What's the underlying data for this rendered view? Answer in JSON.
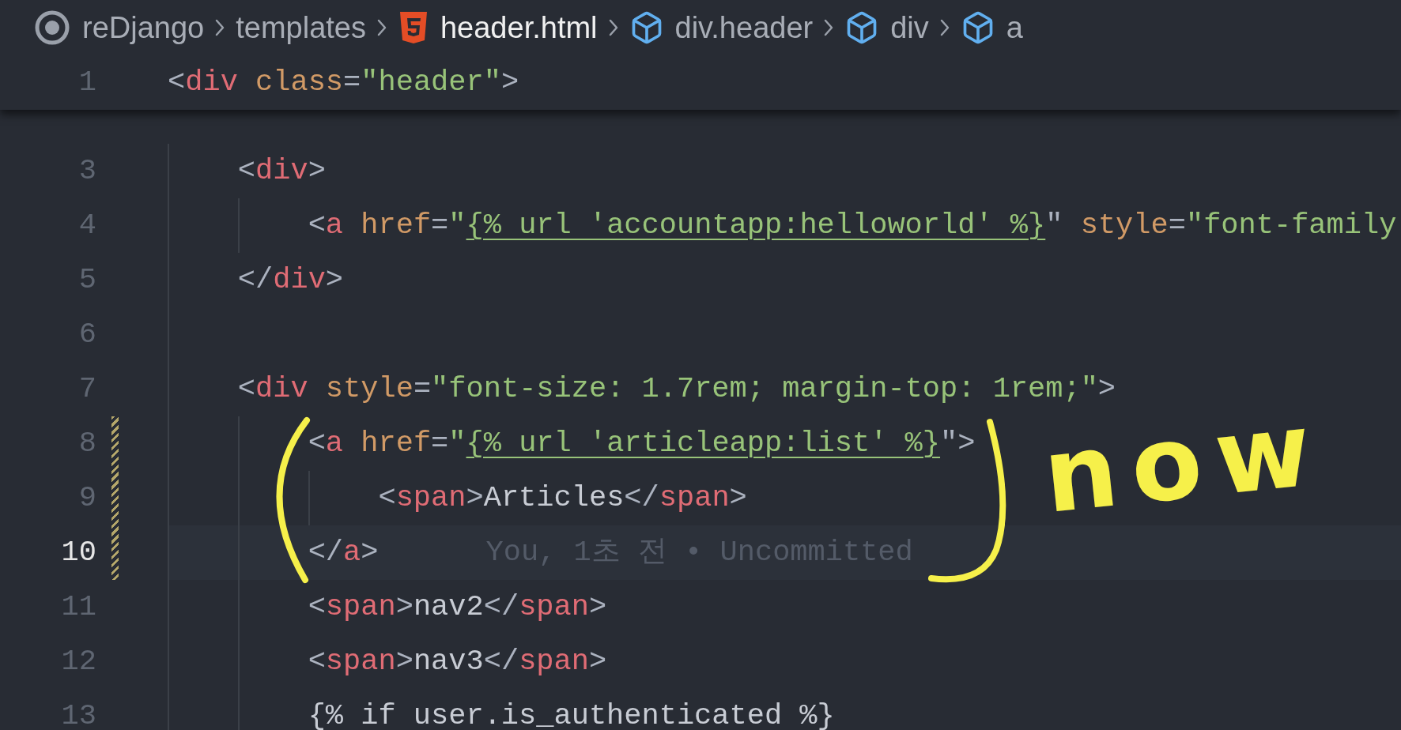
{
  "breadcrumbs": [
    {
      "kind": "root",
      "label": "reDjango"
    },
    {
      "kind": "folder",
      "label": "templates"
    },
    {
      "kind": "file",
      "label": "header.html"
    },
    {
      "kind": "element",
      "label": "div.header"
    },
    {
      "kind": "element",
      "label": "div"
    },
    {
      "kind": "element",
      "label": "a"
    }
  ],
  "sticky_line": {
    "number": "1",
    "tokens": [
      {
        "kind": "punct",
        "text": "<"
      },
      {
        "kind": "tag",
        "text": "div"
      },
      {
        "kind": "attr",
        "text": " class"
      },
      {
        "kind": "punct",
        "text": "="
      },
      {
        "kind": "str",
        "text": "\"header\""
      },
      {
        "kind": "punct",
        "text": ">"
      }
    ]
  },
  "lines": [
    {
      "number": "3",
      "current": false,
      "modified": false,
      "tokens": [
        {
          "kind": "punct",
          "text": "    <"
        },
        {
          "kind": "tag",
          "text": "div"
        },
        {
          "kind": "punct",
          "text": ">"
        }
      ]
    },
    {
      "number": "4",
      "current": false,
      "modified": false,
      "tokens": [
        {
          "kind": "punct",
          "text": "        <"
        },
        {
          "kind": "tag",
          "text": "a"
        },
        {
          "kind": "attr",
          "text": " href"
        },
        {
          "kind": "punct",
          "text": "="
        },
        {
          "kind": "str",
          "text": "\""
        },
        {
          "kind": "tpl",
          "text": "{% url 'accountapp:helloworld' %}"
        },
        {
          "kind": "punct",
          "text": "\""
        },
        {
          "kind": "attr",
          "text": " style"
        },
        {
          "kind": "punct",
          "text": "="
        },
        {
          "kind": "str",
          "text": "\"font-family"
        }
      ]
    },
    {
      "number": "5",
      "current": false,
      "modified": false,
      "tokens": [
        {
          "kind": "punct",
          "text": "    </"
        },
        {
          "kind": "tag",
          "text": "div"
        },
        {
          "kind": "punct",
          "text": ">"
        }
      ]
    },
    {
      "number": "6",
      "current": false,
      "modified": false
    },
    {
      "number": "7",
      "current": false,
      "modified": false,
      "tokens": [
        {
          "kind": "punct",
          "text": "    <"
        },
        {
          "kind": "tag",
          "text": "div"
        },
        {
          "kind": "attr",
          "text": " style"
        },
        {
          "kind": "punct",
          "text": "="
        },
        {
          "kind": "str",
          "text": "\"font-size: 1.7rem; margin-top: 1rem;\""
        },
        {
          "kind": "punct",
          "text": ">"
        }
      ]
    },
    {
      "number": "8",
      "current": false,
      "modified": true,
      "tokens": [
        {
          "kind": "punct",
          "text": "        <"
        },
        {
          "kind": "tag",
          "text": "a"
        },
        {
          "kind": "attr",
          "text": " href"
        },
        {
          "kind": "punct",
          "text": "="
        },
        {
          "kind": "str",
          "text": "\""
        },
        {
          "kind": "tpl",
          "text": "{% url 'articleapp:list' %}"
        },
        {
          "kind": "punct",
          "text": "\">"
        }
      ]
    },
    {
      "number": "9",
      "current": false,
      "modified": true,
      "tokens": [
        {
          "kind": "punct",
          "text": "            <"
        },
        {
          "kind": "tag",
          "text": "span"
        },
        {
          "kind": "punct",
          "text": ">"
        },
        {
          "kind": "text",
          "text": "Articles"
        },
        {
          "kind": "punct",
          "text": "</"
        },
        {
          "kind": "tag",
          "text": "span"
        },
        {
          "kind": "punct",
          "text": ">"
        }
      ]
    },
    {
      "number": "10",
      "current": true,
      "modified": true,
      "tokens": [
        {
          "kind": "punct",
          "text": "        </"
        },
        {
          "kind": "tag",
          "text": "a"
        },
        {
          "kind": "punct",
          "text": ">"
        }
      ],
      "blame": "You, 1초 전 • Uncommitted"
    },
    {
      "number": "11",
      "current": false,
      "modified": false,
      "tokens": [
        {
          "kind": "punct",
          "text": "        <"
        },
        {
          "kind": "tag",
          "text": "span"
        },
        {
          "kind": "punct",
          "text": ">"
        },
        {
          "kind": "text",
          "text": "nav2"
        },
        {
          "kind": "punct",
          "text": "</"
        },
        {
          "kind": "tag",
          "text": "span"
        },
        {
          "kind": "punct",
          "text": ">"
        }
      ]
    },
    {
      "number": "12",
      "current": false,
      "modified": false,
      "tokens": [
        {
          "kind": "punct",
          "text": "        <"
        },
        {
          "kind": "tag",
          "text": "span"
        },
        {
          "kind": "punct",
          "text": ">"
        },
        {
          "kind": "text",
          "text": "nav3"
        },
        {
          "kind": "punct",
          "text": "</"
        },
        {
          "kind": "tag",
          "text": "span"
        },
        {
          "kind": "punct",
          "text": ">"
        }
      ]
    },
    {
      "number": "13",
      "current": false,
      "modified": false,
      "tokens": [
        {
          "kind": "text",
          "text": "        {% if user.is_authenticated %}"
        }
      ]
    }
  ],
  "annotations": [
    {
      "kind": "open-paren"
    },
    {
      "kind": "close-paren"
    },
    {
      "kind": "text",
      "text": "now"
    }
  ]
}
